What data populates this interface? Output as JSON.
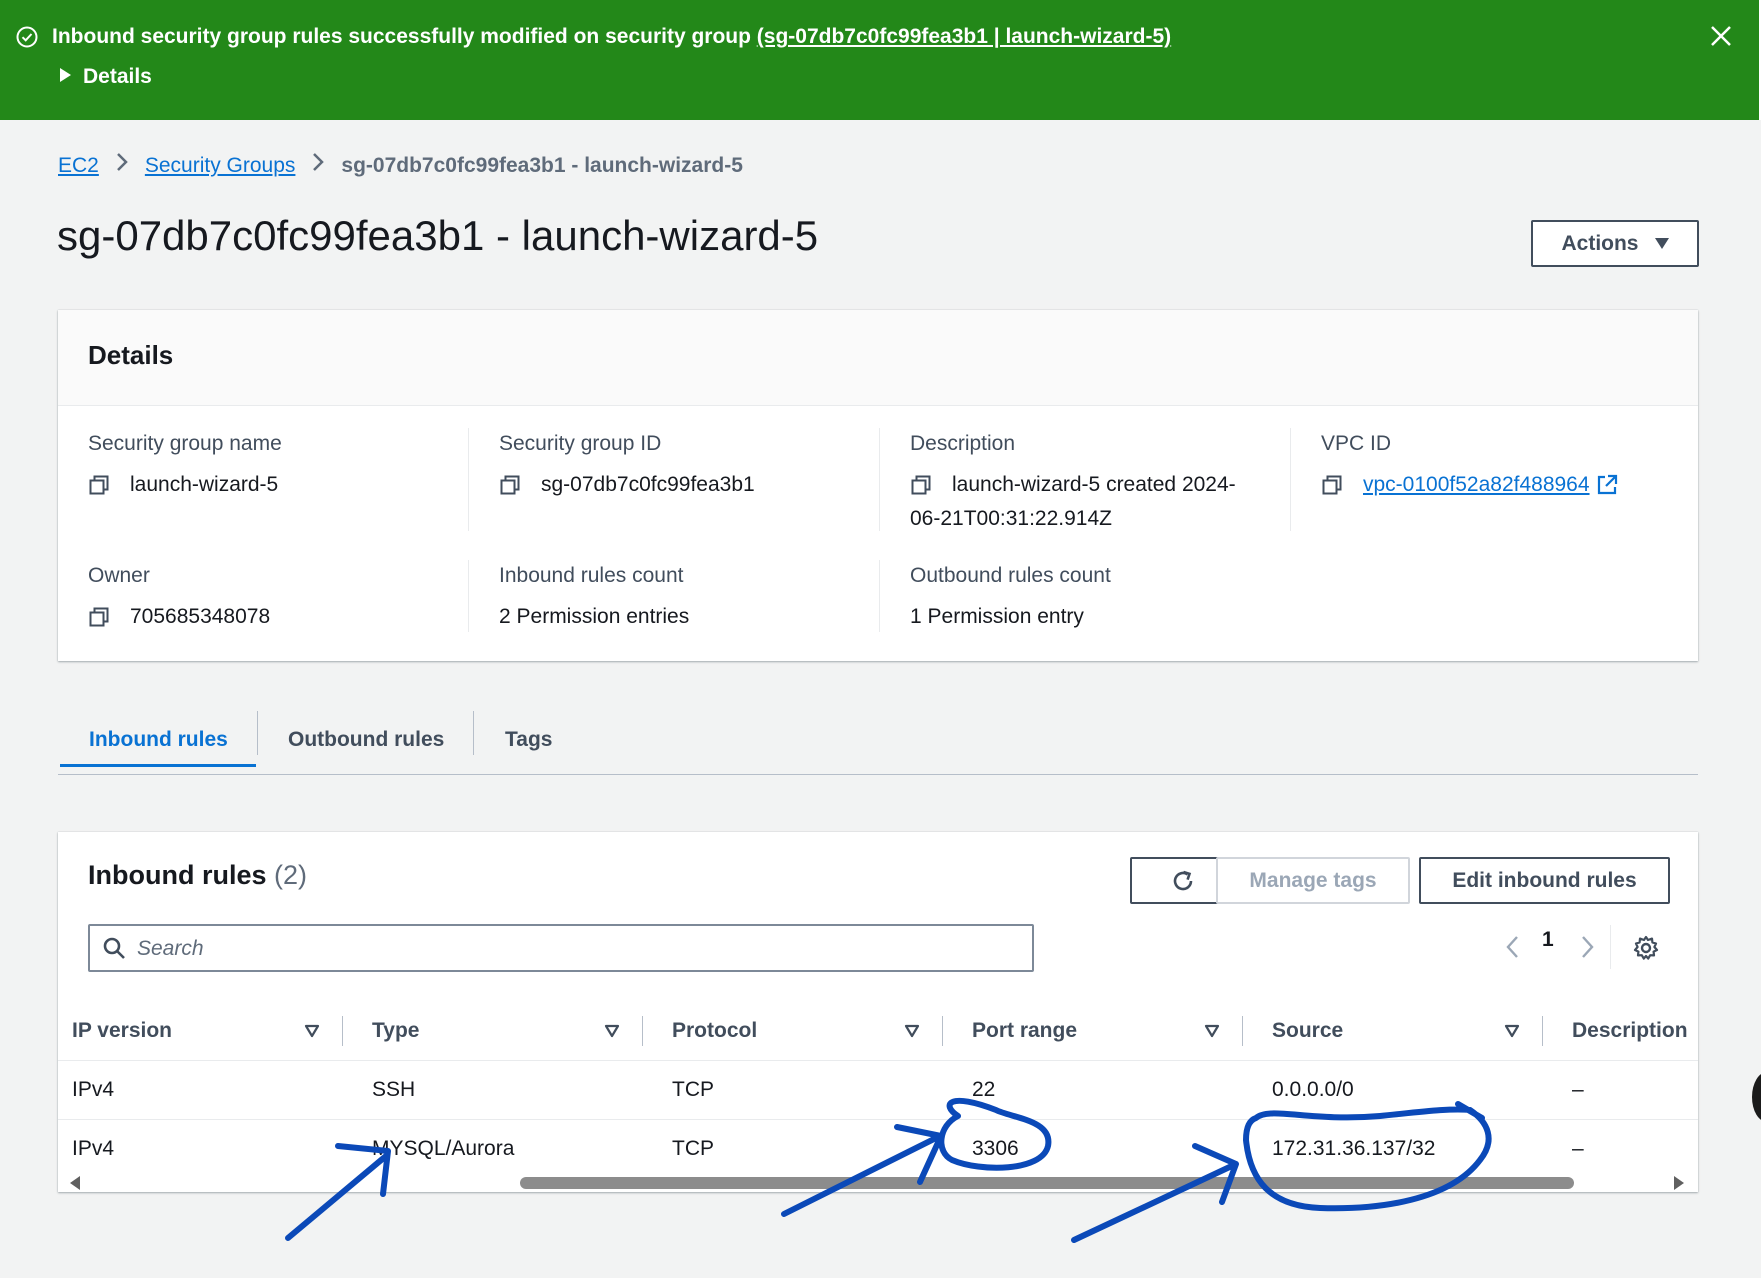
{
  "flash": {
    "message": "Inbound security group rules successfully modified on security group ",
    "link": "(sg-07db7c0fc99fea3b1 | launch-wizard-5)",
    "details": "Details",
    "color": "#238819"
  },
  "breadcrumb": {
    "items": [
      "EC2",
      "Security Groups"
    ],
    "current": "sg-07db7c0fc99fea3b1 - launch-wizard-5"
  },
  "page": {
    "title": "sg-07db7c0fc99fea3b1 - launch-wizard-5",
    "actions": "Actions"
  },
  "details": {
    "heading": "Details",
    "fields": [
      {
        "label": "Security group name",
        "value": "launch-wizard-5"
      },
      {
        "label": "Security group ID",
        "value": "sg-07db7c0fc99fea3b1"
      },
      {
        "label": "Description",
        "value": "launch-wizard-5 created 2024-",
        "value2": "06-21T00:31:22.914Z"
      },
      {
        "label": "VPC ID",
        "value": "vpc-0100f52a82f488964"
      },
      {
        "label": "Owner",
        "value": "705685348078"
      },
      {
        "label": "Inbound rules count",
        "value": "2 Permission entries"
      },
      {
        "label": "Outbound rules count",
        "value": "1 Permission entry"
      }
    ]
  },
  "tabs": [
    "Inbound rules",
    "Outbound rules",
    "Tags"
  ],
  "rules": {
    "title": "Inbound rules",
    "count": "(2)",
    "manage_tags": "Manage tags",
    "edit": "Edit inbound rules",
    "search_placeholder": "Search",
    "page": "1",
    "columns": [
      "IP version",
      "Type",
      "Protocol",
      "Port range",
      "Source",
      "Description"
    ],
    "rows": [
      [
        "IPv4",
        "SSH",
        "TCP",
        "22",
        "0.0.0.0/0",
        "–"
      ],
      [
        "IPv4",
        "MYSQL/Aurora",
        "TCP",
        "3306",
        "172.31.36.137/32",
        "–"
      ]
    ]
  },
  "colors": {
    "link": "#0972d3",
    "annotation": "#0b49b8"
  }
}
